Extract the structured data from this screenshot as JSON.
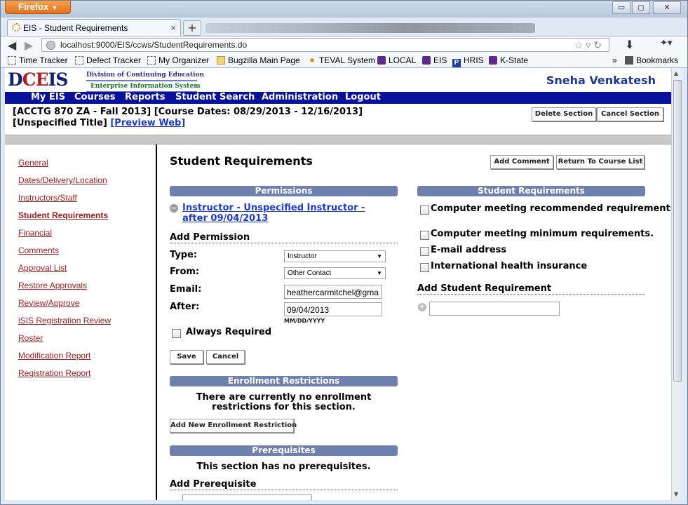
{
  "browser": {
    "menu_button": "Firefox",
    "tab_title": "EIS - Student Requirements",
    "url": "localhost:9000/EIS/ccws/StudentRequirements.do",
    "bookmarks": [
      "Time Tracker",
      "Defect Tracker",
      "My Organizer",
      "Bugzilla Main Page",
      "TEVAL System",
      "LOCAL",
      "EIS",
      "HRIS",
      "K-State"
    ],
    "bookmarks_menu": "Bookmarks",
    "overflow": "»"
  },
  "header": {
    "logo_text_1": "D",
    "logo_text_2": "CE",
    "logo_text_3": "IS",
    "logo_line1": "Division of Continuing Education",
    "logo_line2": "Enterprise Information System",
    "user_name": "Sneha Venkatesh"
  },
  "menu": [
    "My EIS",
    "Courses",
    "Reports",
    "Student Search",
    "Administration",
    "Logout"
  ],
  "course": {
    "line1": "[ACCTG 870 ZA - Fall 2013] [Course Dates: 08/29/2013 - 12/16/2013]",
    "line2": "[Unspecified Title]",
    "preview_link": "[Preview Web]",
    "delete_button": "Delete Section",
    "cancel_button": "Cancel Section"
  },
  "sidebar": {
    "items": [
      "General",
      "Dates/Delivery/Location",
      "Instructors/Staff",
      "Student Requirements",
      "Financial",
      "Comments",
      "Approval List",
      "Restore Approvals",
      "Review/Approve",
      "iSIS Registration Review",
      "Roster",
      "Modification Report",
      "Registration Report"
    ],
    "active_index": 3
  },
  "main": {
    "title": "Student Requirements",
    "add_comment": "Add Comment",
    "return_button": "Return To Course List",
    "permissions": {
      "header": "Permissions",
      "existing": "Instructor - Unspecified Instructor - after 09/04/2013",
      "add_header": "Add Permission",
      "type_label": "Type:",
      "type_value": "Instructor",
      "from_label": "From:",
      "from_value": "Other Contact",
      "email_label": "Email:",
      "email_value": "heathercarmitchel@gma",
      "after_label": "After:",
      "after_value": "09/04/2013",
      "date_hint": "MM/DD/YYYY",
      "always_required": "Always Required",
      "save": "Save",
      "cancel": "Cancel"
    },
    "enrollment": {
      "header": "Enrollment Restrictions",
      "message": "There are currently no enrollment restrictions for this section.",
      "add_button": "Add New Enrollment Restriction"
    },
    "prereq": {
      "header": "Prerequisites",
      "message": "This section has no prerequisites.",
      "add_header": "Add Prerequisite"
    },
    "student_requirements": {
      "header": "Student Requirements",
      "items": [
        "Computer meeting recommended requirements.",
        "Computer meeting minimum requirements.",
        "E-mail address",
        "International health insurance"
      ],
      "add_header": "Add Student Requirement",
      "add_value": ""
    }
  },
  "colors": {
    "brand_blue": "#07119c",
    "section_header": "#6f7fae",
    "nav_link": "#a51e1e",
    "link_blue": "#1b3bd6"
  }
}
